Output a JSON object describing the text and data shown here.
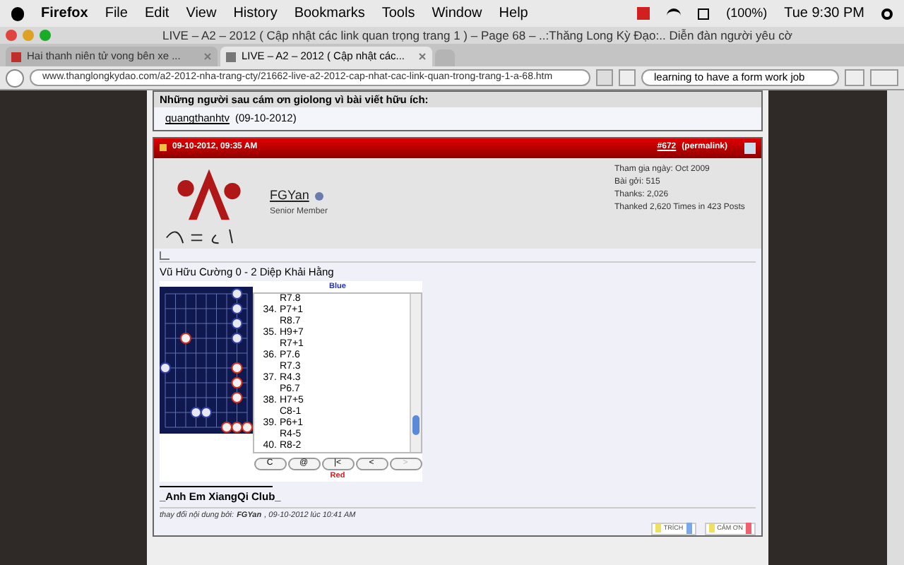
{
  "menu_bar": {
    "app": "Firefox",
    "items": [
      "File",
      "Edit",
      "View",
      "History",
      "Bookmarks",
      "Tools",
      "Window",
      "Help"
    ],
    "battery": "(100%)",
    "clock": "Tue 9:30 PM"
  },
  "window": {
    "title": "LIVE – A2 – 2012 ( Cập nhật các link quan trọng trang 1 ) – Page 68 – ..:Thăng Long Kỳ Đạo:.. Diễn đàn người yêu cờ"
  },
  "tabs": [
    {
      "label": "Hai thanh niên tử vong bên xe ...",
      "selected": false
    },
    {
      "label": "LIVE – A2 – 2012 ( Cập nhật các...",
      "selected": true
    }
  ],
  "address_bar": {
    "url": "www.thanglongkydao.com/a2-2012-nha-trang-cty/21662-live-a2-2012-cap-nhat-cac-link-quan-trong-trang-1-a-68.htm",
    "search": "learning to have a form work job"
  },
  "thanks": {
    "heading": "Những người sau cám ơn giolong vì bài viết hữu ích:",
    "user": "quangthanhtv",
    "date": "(09-10-2012)"
  },
  "post": {
    "date": "09-10-2012, 09:35 AM",
    "number": "#672",
    "permalink": "(permalink)",
    "username": "FGYan",
    "rank": "Senior Member",
    "stats": [
      "Tham gia ngày: Oct 2009",
      "Bài gởi: 515",
      "Thanks: 2,026",
      "Thanked 2,620 Times in 423 Posts"
    ],
    "game_title": "Vũ Hữu Cường 0 - 2 Diệp Khải Hằng",
    "top_player": "Blue",
    "bottom_player": "Red",
    "moves": [
      {
        "move": "R7.8"
      },
      {
        "number": "34.",
        "move": "P7+1"
      },
      {
        "move": "R8.7"
      },
      {
        "number": "35.",
        "move": "H9+7"
      },
      {
        "move": "R7+1"
      },
      {
        "number": "36.",
        "move": "P7.6"
      },
      {
        "move": "R7.3"
      },
      {
        "number": "37.",
        "move": "R4.3"
      },
      {
        "move": "P6.7"
      },
      {
        "number": "38.",
        "move": "H7+5"
      },
      {
        "move": "C8-1"
      },
      {
        "number": "39.",
        "move": "P6+1"
      },
      {
        "move": "R4-5"
      },
      {
        "number": "40.",
        "move": "R8-2"
      }
    ],
    "controls": [
      {
        "label": "C",
        "disabled": false
      },
      {
        "label": "@",
        "disabled": false
      },
      {
        "label": "|<",
        "disabled": false
      },
      {
        "label": "<",
        "disabled": false
      },
      {
        "label": ">",
        "disabled": true
      }
    ],
    "signature": "_Anh Em XiangQi Club_",
    "edit_note": {
      "prefix": "thay đổi nội dung bởi:",
      "editor": "FGYan",
      "suffix": ", 09-10-2012 lúc 10:41 AM"
    },
    "actions": [
      "TRÍCH",
      "CẢM ƠN"
    ]
  }
}
